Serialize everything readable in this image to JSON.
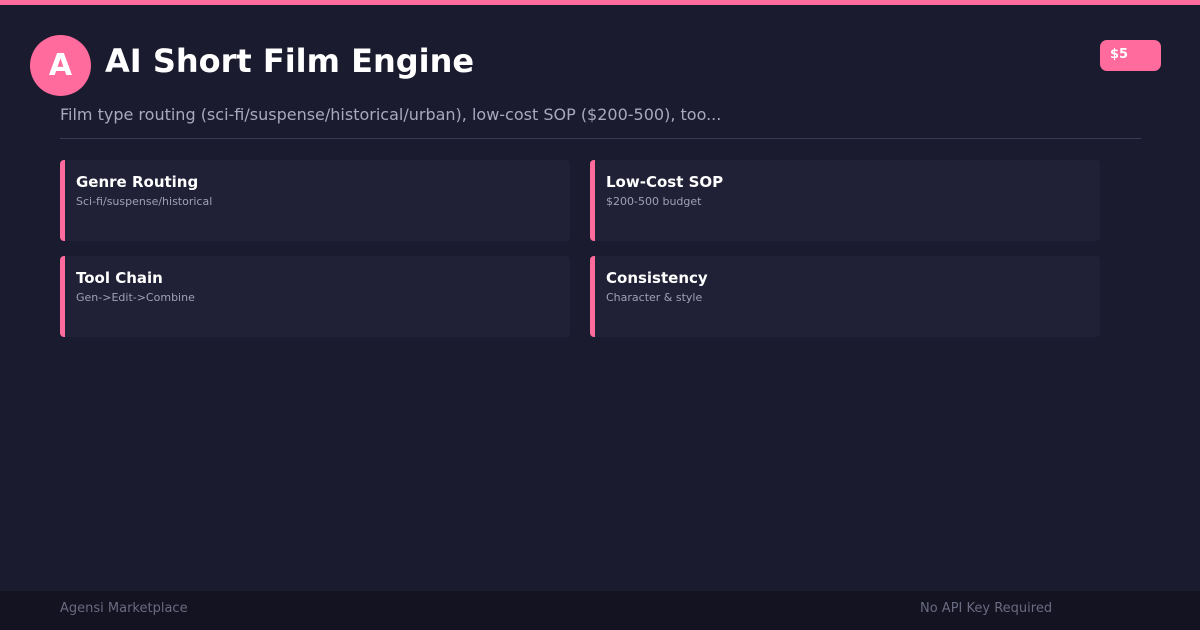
{
  "header": {
    "avatar_letter": "A",
    "title": "AI Short Film Engine",
    "price": "$5",
    "subtitle": "Film type routing (sci-fi/suspense/historical/urban), low-cost SOP ($200-500), too..."
  },
  "features": [
    {
      "title": "Genre Routing",
      "description": "Sci-fi/suspense/historical"
    },
    {
      "title": "Low-Cost SOP",
      "description": "$200-500 budget"
    },
    {
      "title": "Tool Chain",
      "description": "Gen->Edit->Combine"
    },
    {
      "title": "Consistency",
      "description": "Character & style"
    }
  ],
  "footer": {
    "brand": "Agensi Marketplace",
    "note": "No API Key Required"
  },
  "colors": {
    "accent": "#ff6b9d",
    "background": "#1b1b2f",
    "card": "#202036",
    "footer": "#131322"
  }
}
